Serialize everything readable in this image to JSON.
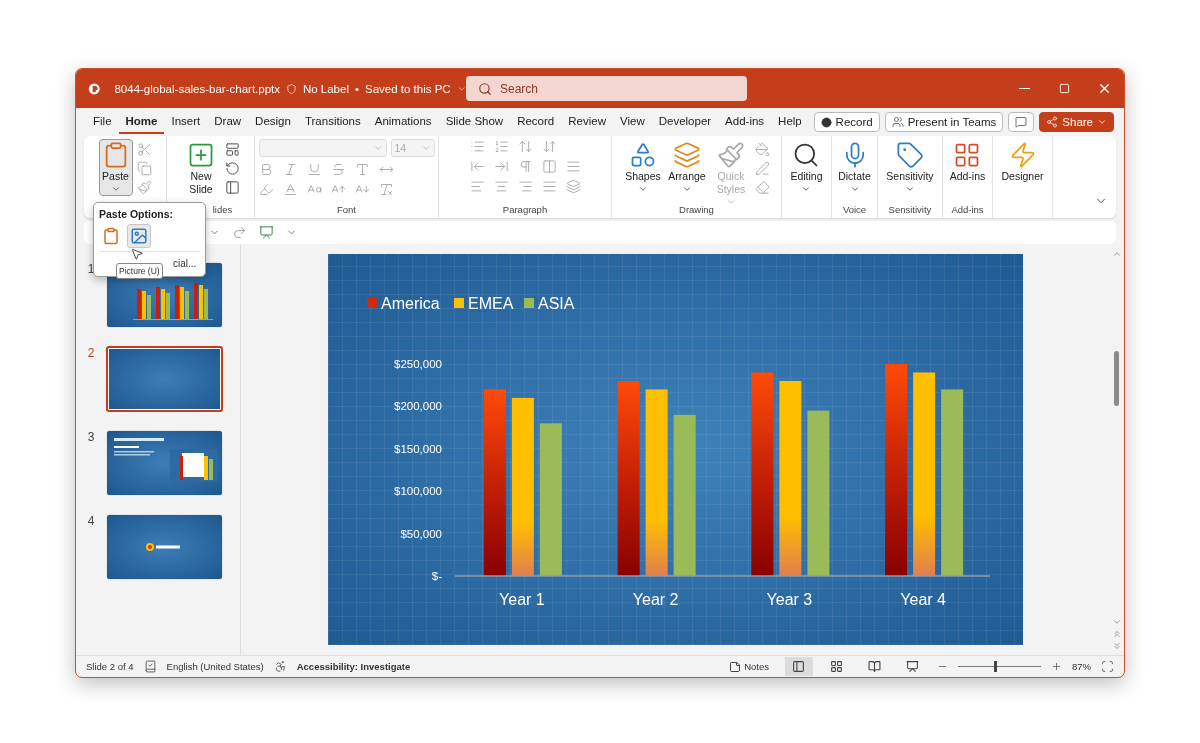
{
  "window": {
    "title": "8044-global-sales-bar-chart.pptx",
    "label": "No Label",
    "separator": "•",
    "save_status": "Saved to this PC"
  },
  "search": {
    "placeholder": "Search"
  },
  "tabs": [
    {
      "label": "File",
      "selected": false
    },
    {
      "label": "Home",
      "selected": true
    },
    {
      "label": "Insert",
      "selected": false
    },
    {
      "label": "Draw",
      "selected": false
    },
    {
      "label": "Design",
      "selected": false
    },
    {
      "label": "Transitions",
      "selected": false
    },
    {
      "label": "Animations",
      "selected": false
    },
    {
      "label": "Slide Show",
      "selected": false
    },
    {
      "label": "Record",
      "selected": false
    },
    {
      "label": "Review",
      "selected": false
    },
    {
      "label": "View",
      "selected": false
    },
    {
      "label": "Developer",
      "selected": false
    },
    {
      "label": "Add-ins",
      "selected": false
    },
    {
      "label": "Help",
      "selected": false
    }
  ],
  "tab_actions": [
    {
      "kind": "record",
      "label": "Record"
    },
    {
      "kind": "teams",
      "label": "Present in Teams"
    },
    {
      "kind": "comments"
    },
    {
      "kind": "share",
      "label": "Share"
    }
  ],
  "ribbon": [
    {
      "kind": "clipboard",
      "tools_disabled": true,
      "buttons": [
        {
          "label": "Paste",
          "pressed": true
        }
      ]
    },
    {
      "kind": "slides",
      "label": "lides",
      "tools_disabled": false,
      "buttons": [
        {
          "label": "New Slide",
          "pressed": false
        }
      ]
    },
    {
      "kind": "font",
      "label": "Font",
      "tools_disabled": true,
      "font_size": "14"
    },
    {
      "kind": "paragraph",
      "label": "Paragraph",
      "tools_disabled": true
    },
    {
      "kind": "drawing",
      "label": "Drawing",
      "tools_disabled": true,
      "buttons": [
        {
          "label": "Shapes",
          "disabled": false
        },
        {
          "label": "Arrange",
          "disabled": false
        },
        {
          "label": "Quick Styles",
          "disabled": true
        }
      ]
    },
    {
      "kind": "editing",
      "buttons": [
        {
          "label": "Editing"
        }
      ]
    },
    {
      "kind": "voice",
      "label": "Voice",
      "buttons": [
        {
          "label": "Dictate"
        }
      ]
    },
    {
      "kind": "sensitivity",
      "label": "Sensitivity",
      "buttons": [
        {
          "label": "Sensitivity"
        }
      ]
    },
    {
      "kind": "addins",
      "label": "Add-ins",
      "buttons": [
        {
          "label": "Add-ins"
        }
      ]
    },
    {
      "kind": "designer",
      "buttons": [
        {
          "label": "Designer"
        }
      ]
    }
  ],
  "paste_menu": {
    "title": "Paste Options:",
    "options": [
      {
        "selected": false
      },
      {
        "selected": true
      }
    ],
    "partial_item": "cial...",
    "tooltip": "Picture (U)"
  },
  "slides": [
    {
      "number": "1",
      "kind": "chart",
      "selected": false
    },
    {
      "number": "2",
      "kind": "blank",
      "selected": true
    },
    {
      "number": "3",
      "kind": "content",
      "selected": false
    },
    {
      "number": "4",
      "kind": "logo",
      "selected": false
    }
  ],
  "chart_data": {
    "type": "bar",
    "categories": [
      "Year 1",
      "Year 2",
      "Year 3",
      "Year 4"
    ],
    "series": [
      {
        "name": "America",
        "color": "#d42a0c",
        "values": [
          220000,
          230000,
          240000,
          250000
        ]
      },
      {
        "name": "EMEA",
        "color": "#ffc000",
        "values": [
          210000,
          220000,
          230000,
          240000
        ]
      },
      {
        "name": "ASIA",
        "color": "#9bbb59",
        "values": [
          180000,
          190000,
          195000,
          220000
        ]
      }
    ],
    "legend": "top",
    "ylim": [
      0,
      250000
    ],
    "yticks": [
      {
        "value": 0,
        "label": "$-"
      },
      {
        "value": 50000,
        "label": "$50,000"
      },
      {
        "value": 100000,
        "label": "$100,000"
      },
      {
        "value": 150000,
        "label": "$150,000"
      },
      {
        "value": 200000,
        "label": "$200,000"
      },
      {
        "value": 250000,
        "label": "$250,000"
      }
    ]
  },
  "status_bar": {
    "slide_info": "Slide 2 of 4",
    "language": "English (United States)",
    "accessibility": "Accessibility: Investigate",
    "notes": "Notes",
    "views": [
      {
        "selected": true
      },
      {
        "selected": false
      },
      {
        "selected": false
      },
      {
        "selected": false
      }
    ],
    "zoom": {
      "level": 0.43,
      "reading": "87%"
    }
  }
}
